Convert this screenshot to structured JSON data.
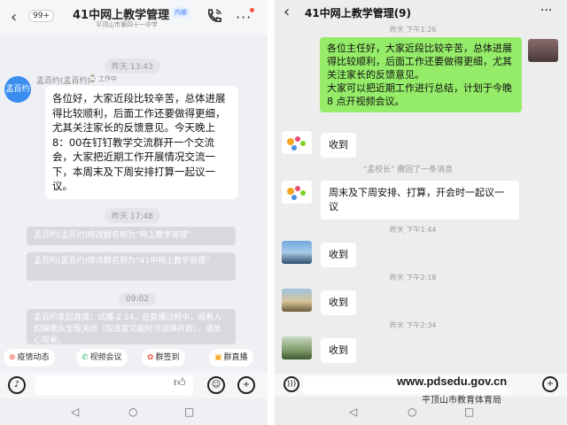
{
  "left": {
    "header": {
      "unread_badge": "99+",
      "title": "41中网上教学管理",
      "internal_tag": "内部",
      "subtitle": "平顶山市第四十一中学"
    },
    "timestamps": [
      "昨天 13:43",
      "昨天 17:48",
      "09:02"
    ],
    "message": {
      "avatar_text": "孟百约",
      "sender": "孟百约(孟百约)",
      "sender_tag": "工作中",
      "text": "各位好，大家近段比较辛苦，总体进展得比较顺利，后面工作还要做得更细，尤其关注家长的反馈意见。今天晚上8：00在钉钉教学交流群开一个交流会，大家把近期工作开展情况交流一下，本周末及下周安排打算一起议一议。"
    },
    "system_notices": [
      "孟百约(孟百约)修改群名称为“网上教学管理”",
      "孟百约(孟百约)修改群名称为“41中网上教学管理”",
      "孟百约发起直播：试播-2.14，在直播过程中，观看人的摄像头全程关闭（仅连麦功能时可选择开启），请放心观看。"
    ],
    "quick_actions": [
      {
        "icon": "⊕",
        "label": "疫情动态"
      },
      {
        "icon": "✆",
        "label": "视频会议"
      },
      {
        "icon": "✿",
        "label": "群签到"
      },
      {
        "icon": "▣",
        "label": "群直播"
      }
    ]
  },
  "right": {
    "header": {
      "title": "41中网上教学管理(9)"
    },
    "timestamps": [
      "昨天 下午1:26",
      "昨天 下午1:44",
      "昨天 下午2:18",
      "昨天 下午2:34"
    ],
    "own_message": "各位主任好，大家近段比较辛苦，总体进展得比较顺利，后面工作还要做得更细，尤其关注家长的反馈意见。\n大家可以把近期工作进行总结，计划于今晚 8 点开视频会议。",
    "recall_notice": "\"孟校长\" 撤回了一条消息",
    "replies": [
      "收到",
      "周末及下周安排、打算，开会时一起议一议",
      "收到",
      "收到",
      "收到"
    ]
  },
  "watermark": {
    "url": "www.pdsedu.gov.cn",
    "org": "平顶山市教育体育局"
  },
  "colors": {
    "wechat_green": "#95ec69",
    "dingtalk_blue": "#3b8ef0"
  }
}
